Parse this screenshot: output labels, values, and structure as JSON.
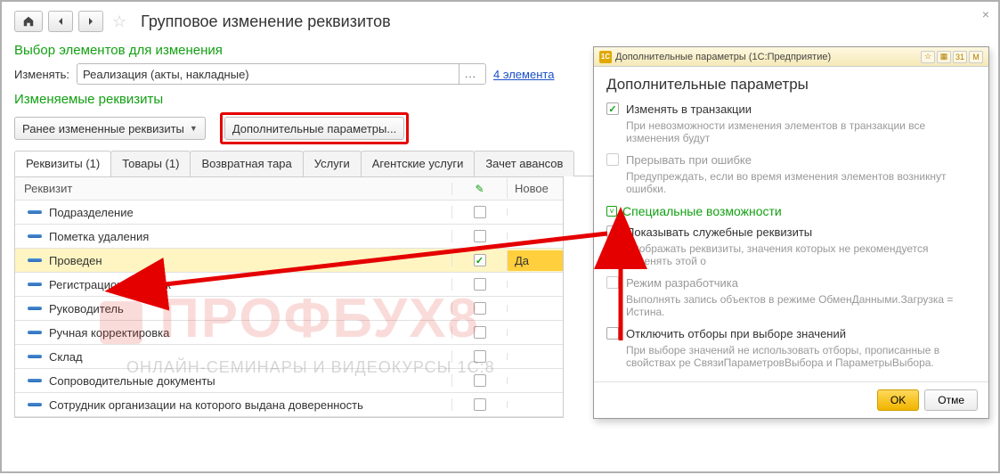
{
  "header": {
    "title": "Групповое изменение реквизитов"
  },
  "selection": {
    "section_title": "Выбор элементов для изменения",
    "change_label": "Изменять:",
    "change_value": "Реализация (акты, накладные)",
    "elements_link": "4 элемента"
  },
  "editable": {
    "section_title": "Изменяемые реквизиты",
    "prev_changed_btn": "Ранее измененные реквизиты",
    "additional_params_btn": "Дополнительные параметры..."
  },
  "tabs": [
    {
      "label": "Реквизиты (1)"
    },
    {
      "label": "Товары (1)"
    },
    {
      "label": "Возвратная тара"
    },
    {
      "label": "Услуги"
    },
    {
      "label": "Агентские услуги"
    },
    {
      "label": "Зачет авансов"
    }
  ],
  "table": {
    "header_name": "Реквизит",
    "header_value": "Новое",
    "rows": [
      {
        "name": "Подразделение",
        "checked": false,
        "value": ""
      },
      {
        "name": "Пометка удаления",
        "checked": false,
        "value": ""
      },
      {
        "name": "Проведен",
        "checked": true,
        "value": "Да",
        "selected": true
      },
      {
        "name": "Регистрационный знак",
        "checked": false,
        "value": ""
      },
      {
        "name": "Руководитель",
        "checked": false,
        "value": ""
      },
      {
        "name": "Ручная корректировка",
        "checked": false,
        "value": ""
      },
      {
        "name": "Склад",
        "checked": false,
        "value": ""
      },
      {
        "name": "Сопроводительные документы",
        "checked": false,
        "value": ""
      },
      {
        "name": "Сотрудник организации на которого выдана доверенность",
        "checked": false,
        "value": ""
      }
    ]
  },
  "popup": {
    "titlebar": "Дополнительные параметры   (1С:Предприятие)",
    "heading": "Дополнительные параметры",
    "change_in_trans": {
      "checked": true,
      "label": "Изменять в транзакции"
    },
    "change_in_trans_desc": "При невозможности изменения элементов в транзакции все изменения будут",
    "interrupt_on_error": {
      "checked": false,
      "label": "Прерывать при ошибке"
    },
    "interrupt_desc": "Предупреждать, если во время изменения элементов возникнут ошибки.",
    "special_section": "Специальные возможности",
    "show_service": {
      "checked": true,
      "label": "Показывать служебные реквизиты"
    },
    "show_service_desc": "Отображать реквизиты, значения которых не рекомендуется изменять этой о",
    "dev_mode": {
      "checked": false,
      "label": "Режим разработчика"
    },
    "dev_mode_desc": "Выполнять запись объектов в режиме ОбменДанными.Загрузка = Истина.",
    "disable_filters": {
      "checked": false,
      "label": "Отключить отборы при выборе значений"
    },
    "disable_filters_desc": "При выборе значений не использовать отборы, прописанные в свойствах ре СвязиПараметровВыбора и ПараметрыВыбора.",
    "ok_btn": "OK",
    "cancel_btn": "Отме"
  },
  "watermark": {
    "main": "ПРОФБУХ8",
    "sub": "ОНЛАЙН-СЕМИНАРЫ И ВИДЕОКУРСЫ 1С:8"
  }
}
